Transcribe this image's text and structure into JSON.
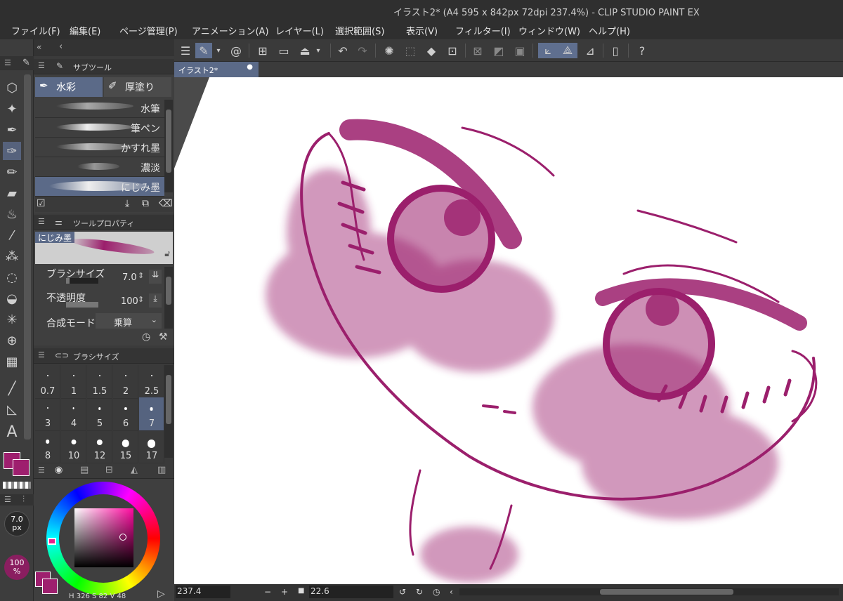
{
  "window": {
    "title": "イラスト2* (A4 595 x 842px 72dpi 237.4%)  - CLIP STUDIO PAINT EX"
  },
  "menu": [
    "ファイル(F)",
    "編集(E)",
    "ページ管理(P)",
    "アニメーション(A)",
    "レイヤー(L)",
    "選択範囲(S)",
    "表示(V)",
    "フィルター(I)",
    "ウィンドウ(W)",
    "ヘルプ(H)"
  ],
  "subtool_panel": {
    "title": "サブツール",
    "tabs": [
      {
        "label": "水彩",
        "active": true
      },
      {
        "label": "厚塗り",
        "active": false
      }
    ],
    "brushes": [
      {
        "label": "水筆",
        "selected": false
      },
      {
        "label": "筆ペン",
        "selected": false
      },
      {
        "label": "かすれ墨",
        "selected": false
      },
      {
        "label": "濃淡",
        "selected": false
      },
      {
        "label": "にじみ墨",
        "selected": true
      }
    ]
  },
  "tool_property": {
    "title": "ツールプロパティ",
    "preset_name": "にじみ墨",
    "brush_size": {
      "label": "ブラシサイズ",
      "value": "7.0",
      "fill": 0.1
    },
    "opacity": {
      "label": "不透明度",
      "value": "100",
      "fill": 1.0
    },
    "blend_mode": {
      "label": "合成モード",
      "value": "乗算"
    }
  },
  "brush_size_panel": {
    "title": "ブラシサイズ",
    "sizes": [
      {
        "label": "0.7",
        "active": false
      },
      {
        "label": "1",
        "active": false
      },
      {
        "label": "1.5",
        "active": false
      },
      {
        "label": "2",
        "active": false
      },
      {
        "label": "2.5",
        "active": false
      },
      {
        "label": "3",
        "active": false
      },
      {
        "label": "4",
        "active": false
      },
      {
        "label": "5",
        "active": false
      },
      {
        "label": "6",
        "active": false
      },
      {
        "label": "7",
        "active": true
      },
      {
        "label": "8",
        "active": false
      },
      {
        "label": "10",
        "active": false
      },
      {
        "label": "12",
        "active": false
      },
      {
        "label": "15",
        "active": false
      },
      {
        "label": "17",
        "active": false
      }
    ]
  },
  "brush_indicator": {
    "size": "7.0",
    "unit": "px",
    "opacity": "100",
    "opacity_unit": "%"
  },
  "colors": {
    "main": "#9e1f6e",
    "sub": "#9e1f6e",
    "stroke": "#9b1f6c",
    "accent": "#5b6a88"
  },
  "color_readout": {
    "h_label": "H",
    "h": "326",
    "s_label": "S",
    "s": "82",
    "v_label": "V",
    "v": "48"
  },
  "document_tab": {
    "label": "イラスト2*"
  },
  "status": {
    "zoom": "237.4",
    "rotation": "22.6"
  },
  "icons": {
    "left_tools": [
      "object-icon",
      "effect-icon",
      "pen-icon",
      "brush-icon",
      "pencil-icon",
      "eraser-icon",
      "blend-icon",
      "eyedropper-icon",
      "airbrush-icon",
      "lasso-icon",
      "fill-icon",
      "magic-wand-icon",
      "mesh-icon",
      "gradient-icon",
      "line-icon",
      "ruler-icon",
      "text-icon"
    ]
  }
}
